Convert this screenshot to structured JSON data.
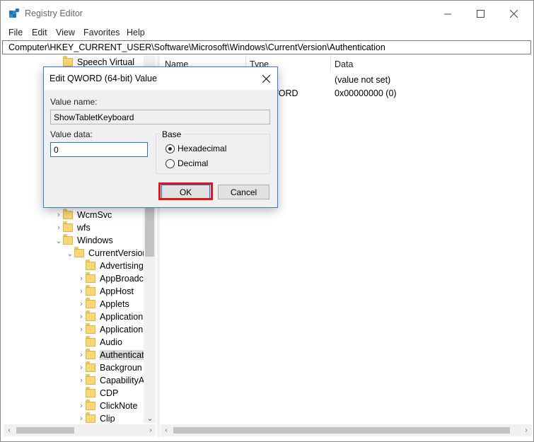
{
  "window": {
    "title": "Registry Editor"
  },
  "menu": [
    "File",
    "Edit",
    "View",
    "Favorites",
    "Help"
  ],
  "address": "Computer\\HKEY_CURRENT_USER\\Software\\Microsoft\\Windows\\CurrentVersion\\Authentication",
  "tree": {
    "top_item": "Speech Virtual",
    "items": [
      "WcmSvc",
      "wfs",
      "Windows",
      "CurrentVersion",
      "Advertising",
      "AppBroadc",
      "AppHost",
      "Applets",
      "Application",
      "Application",
      "Audio",
      "Authenticat",
      "Backgroun",
      "CapabilityA",
      "CDP",
      "ClickNote",
      "Clip"
    ]
  },
  "list": {
    "columns": {
      "name": "Name",
      "type": "Type",
      "data": "Data"
    },
    "rows": [
      {
        "type": "",
        "data": "(value not set)"
      },
      {
        "type": "WORD",
        "data": "0x00000000 (0)"
      }
    ]
  },
  "dialog": {
    "title": "Edit QWORD (64-bit) Value",
    "value_name_label": "Value name:",
    "value_name": "ShowTabletKeyboard",
    "value_data_label": "Value data:",
    "value_data": "0",
    "base_label": "Base",
    "hex_label": "Hexadecimal",
    "dec_label": "Decimal",
    "selected_base": "Hexadecimal",
    "ok_label": "OK",
    "cancel_label": "Cancel"
  },
  "colors": {
    "highlight": "#e0161b",
    "accent": "#0078d7",
    "folder": "#f8d775"
  }
}
